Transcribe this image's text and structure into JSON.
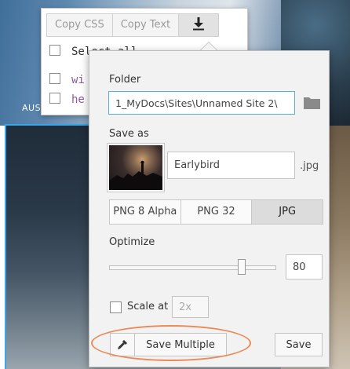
{
  "background": {
    "caption": "AUS"
  },
  "back_menu": {
    "tabs": [
      "Copy CSS",
      "Copy Text"
    ],
    "download_icon": "download-arrow-icon",
    "rows": [
      "Select all",
      "wi",
      "he"
    ]
  },
  "export": {
    "folder_label": "Folder",
    "folder_value": "1_MyDocs\\Sites\\Unnamed Site 2\\",
    "folder_icon": "folder-icon",
    "save_as_label": "Save as",
    "file_name": "Earlybird",
    "extension": ".jpg",
    "formats": [
      "PNG 8 Alpha",
      "PNG 32",
      "JPG"
    ],
    "selected_format": "JPG",
    "optimize_label": "Optimize",
    "optimize_value": "80",
    "optimize_fraction": 0.8,
    "scale_label": "Scale at",
    "scale_value": "2x",
    "scale_checked": false,
    "eyedropper_icon": "eyedropper-icon",
    "save_multiple_label": "Save Multiple",
    "save_label": "Save"
  },
  "colors": {
    "focus": "#5aaee6",
    "highlight": "#ea8a58",
    "selection": "#38a6e8"
  }
}
